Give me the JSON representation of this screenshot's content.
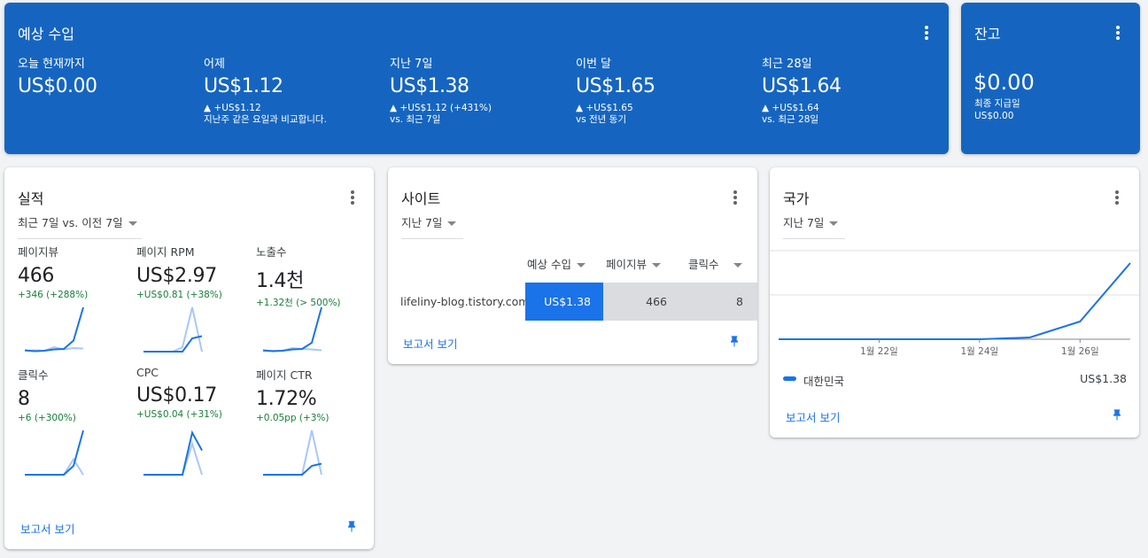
{
  "colors": {
    "header_blue": "#1565c0",
    "accent_blue": "#1a73e8",
    "light_blue": "#a8c7fa",
    "positive_green": "#188038"
  },
  "earnings": {
    "title": "예상 수입",
    "items": [
      {
        "label": "오늘 현재까지",
        "value": "US$0.00",
        "delta": "",
        "note": ""
      },
      {
        "label": "어제",
        "value": "US$1.12",
        "delta": "▲ +US$1.12",
        "note": "지난주 같은 요일과 비교합니다."
      },
      {
        "label": "지난 7일",
        "value": "US$1.38",
        "delta": "▲ +US$1.12 (+431%)",
        "note": "vs. 최근 7일"
      },
      {
        "label": "이번 달",
        "value": "US$1.65",
        "delta": "▲ +US$1.65",
        "note": "vs 전년 동기"
      },
      {
        "label": "최근 28일",
        "value": "US$1.64",
        "delta": "▲ +US$1.64",
        "note": "vs. 최근 28일"
      }
    ]
  },
  "balance": {
    "title": "잔고",
    "value": "$0.00",
    "label": "최종 지급일",
    "sub": "US$0.00"
  },
  "performance": {
    "title": "실적",
    "range": "최근 7일 vs. 이전 7일",
    "metrics": [
      {
        "label": "페이지뷰",
        "value": "466",
        "delta": "+346 (+288%)",
        "current": [
          0.03,
          0.01,
          0.02,
          0.05,
          0.06,
          0.25,
          1.0
        ],
        "previous": [
          0.02,
          0.03,
          0.02,
          0.1,
          0.05,
          0.08,
          0.07
        ]
      },
      {
        "label": "페이지 RPM",
        "value": "US$2.97",
        "delta": "+US$0.81 (+38%)",
        "current": [
          0,
          0,
          0,
          0,
          0,
          0.3,
          0.35
        ],
        "previous": [
          0,
          0,
          0,
          0,
          0.1,
          1.0,
          0
        ]
      },
      {
        "label": "노출수",
        "value": "1.4천",
        "delta": "+1.32천 (> 500%)",
        "current": [
          0.03,
          0.01,
          0.02,
          0.05,
          0.06,
          0.2,
          1.0
        ],
        "previous": [
          0.01,
          0.02,
          0.02,
          0.08,
          0.06,
          0.05,
          0.03
        ]
      },
      {
        "label": "클릭수",
        "value": "8",
        "delta": "+6 (+300%)",
        "current": [
          0,
          0,
          0,
          0,
          0,
          0.2,
          1.0
        ],
        "previous": [
          0,
          0,
          0,
          0,
          0,
          0.35,
          0
        ]
      },
      {
        "label": "CPC",
        "value": "US$0.17",
        "delta": "+US$0.04 (+31%)",
        "current": [
          0,
          0,
          0,
          0,
          0,
          0.95,
          0.55
        ],
        "previous": [
          0,
          0,
          0,
          0,
          0,
          0.7,
          0
        ]
      },
      {
        "label": "페이지 CTR",
        "value": "1.72%",
        "delta": "+0.05pp (+3%)",
        "current": [
          0,
          0,
          0,
          0,
          0,
          0.2,
          0.25
        ],
        "previous": [
          0,
          0,
          0,
          0,
          0,
          1.0,
          0
        ]
      }
    ],
    "link": "보고서 보기"
  },
  "sites": {
    "title": "사이트",
    "range": "지난 7일",
    "columns": [
      "예상 수입",
      "페이지뷰",
      "클릭수"
    ],
    "rows": [
      {
        "site": "lifeliny-blog.tistory.com",
        "earnings": "US$1.38",
        "pageviews": "466",
        "clicks": "8"
      }
    ],
    "link": "보고서 보기"
  },
  "countries": {
    "title": "국가",
    "range": "지난 7일",
    "legend": {
      "name": "대한민국",
      "value": "US$1.38"
    },
    "link": "보고서 보기",
    "chart_data": {
      "type": "line",
      "x": [
        "1월 20일",
        "1월 21일",
        "1월 22일",
        "1월 23일",
        "1월 24일",
        "1월 25일",
        "1월 26일",
        "1월 27일"
      ],
      "tick_labels": [
        "1월 22일",
        "1월 24일",
        "1월 26일"
      ],
      "series": [
        {
          "name": "대한민국",
          "values": [
            0,
            0,
            0,
            0,
            0,
            0.02,
            0.2,
            0.86
          ]
        }
      ],
      "ylim": [
        0,
        1
      ],
      "grid": true
    }
  }
}
